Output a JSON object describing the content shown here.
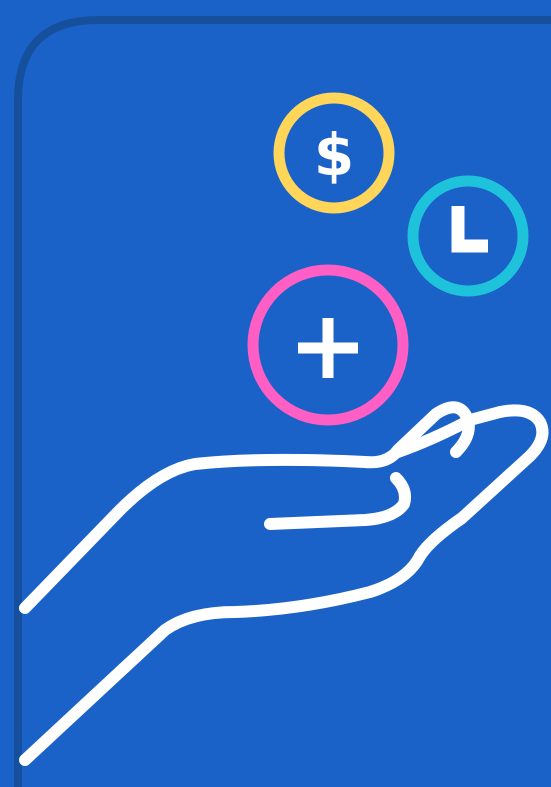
{
  "illustration": {
    "icons": [
      {
        "name": "dollar-coin-icon",
        "glyph": "$",
        "ring_color": "#ffd55a"
      },
      {
        "name": "clock-icon",
        "glyph": "L",
        "ring_color": "#1ec2da"
      },
      {
        "name": "plus-icon",
        "glyph": "+",
        "ring_color": "#ff5ec4"
      },
      {
        "name": "open-hand-icon",
        "glyph": "",
        "ring_color": "#ffffff"
      }
    ]
  },
  "colors": {
    "background": "#1b62c8",
    "panel_edge": "#164f9c",
    "stroke": "#ffffff",
    "glyph": "#ffffff"
  }
}
